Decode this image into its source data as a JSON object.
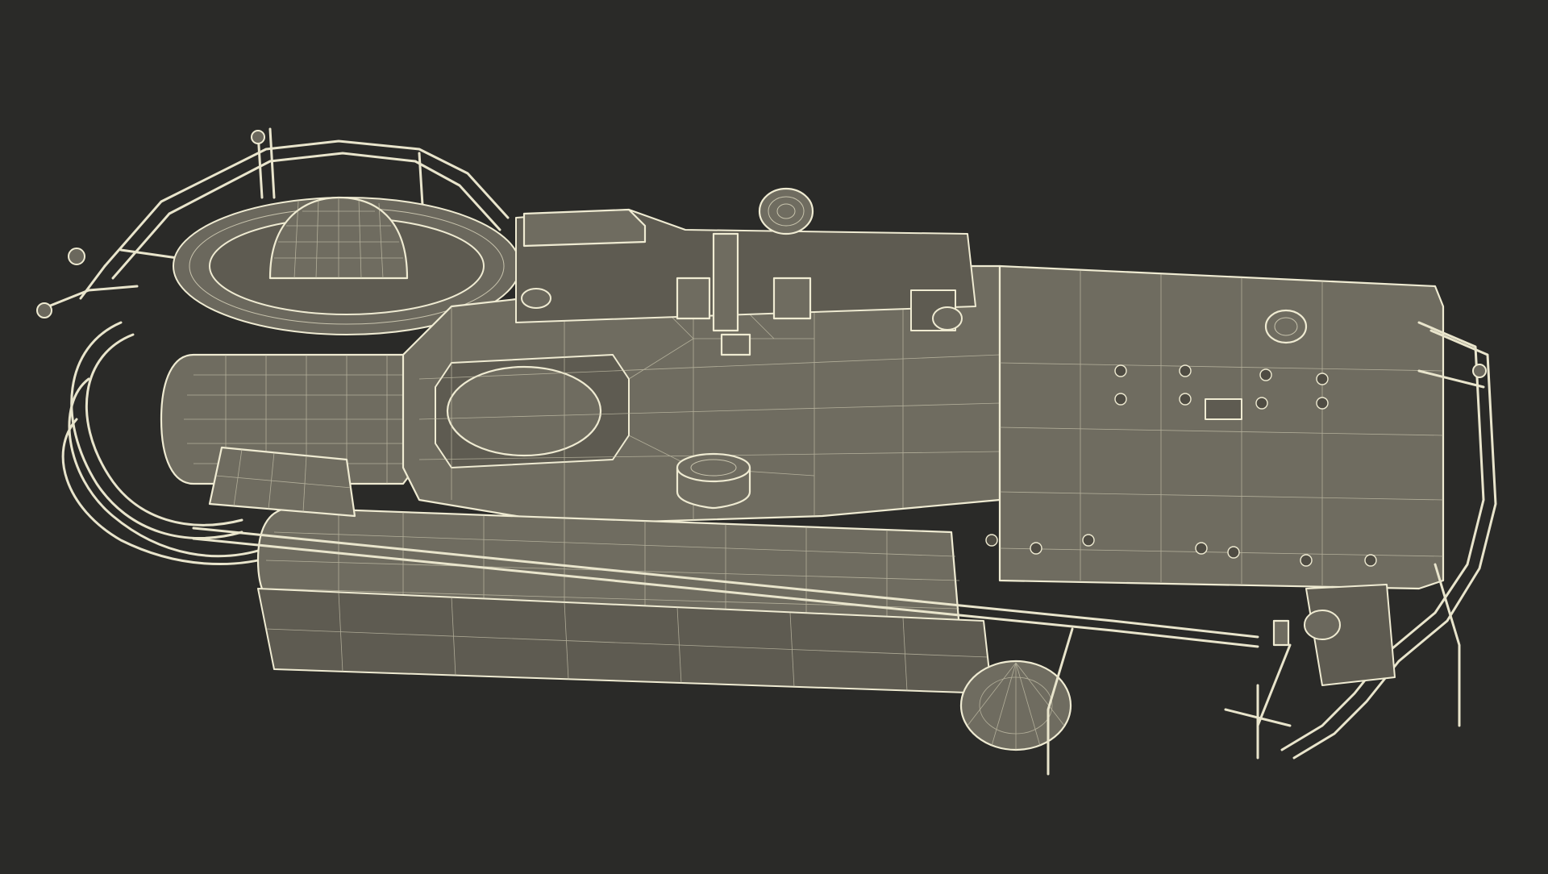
{
  "scene": {
    "subject": "wireframe-submersible",
    "background_color": "#2a2a28",
    "hull_color": "#6f6c60",
    "wire_color": "#efebd2"
  }
}
